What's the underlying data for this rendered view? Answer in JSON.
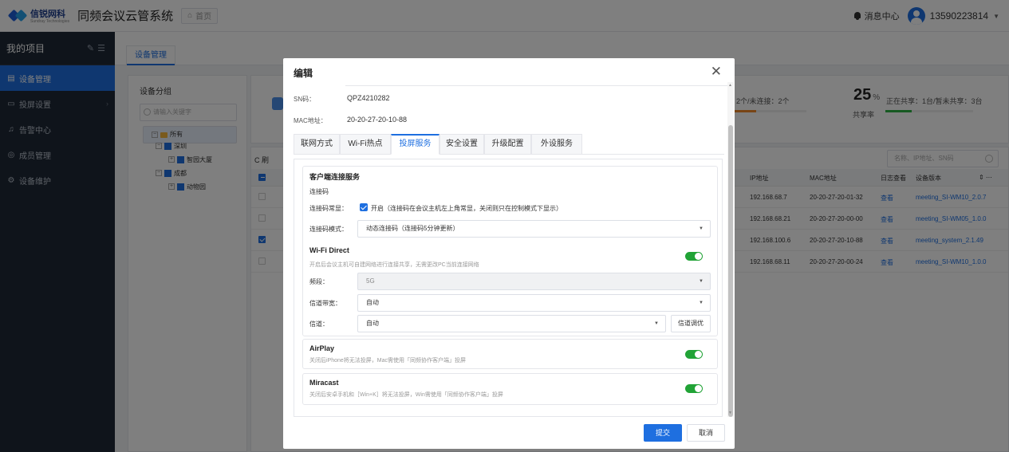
{
  "header": {
    "logo_text": "信锐网科",
    "logo_sub": "Sundray Technologies",
    "app_title": "同频会议云管系统",
    "home_label": "首页",
    "messages_label": "消息中心",
    "username": "13590223814"
  },
  "sidebar": {
    "title": "我的项目",
    "items": [
      {
        "label": "设备管理",
        "icon": "device-icon"
      },
      {
        "label": "投屏设置",
        "icon": "screen-icon"
      },
      {
        "label": "告警中心",
        "icon": "bell-icon"
      },
      {
        "label": "成员管理",
        "icon": "user-icon"
      },
      {
        "label": "设备维护",
        "icon": "wrench-icon"
      }
    ]
  },
  "page": {
    "tab": "设备管理",
    "group_panel": {
      "title": "设备分组",
      "search_placeholder": "请输入关键字",
      "tree": [
        {
          "label": "所有"
        },
        {
          "label": "深圳"
        },
        {
          "label": "智园大厦"
        },
        {
          "label": "成都"
        },
        {
          "label": "动物园"
        }
      ]
    },
    "stats": {
      "connect_text": "2个/未连接：2个",
      "share_pct": "25",
      "share_unit": "%",
      "share_label": "共享率",
      "share_text": "正在共享：1台/暂未共享：3台",
      "connect_fraction": 0.3,
      "share_fraction": 0.3
    },
    "list": {
      "refresh_label": "刷",
      "search_placeholder": "名称、IP地址、SN码",
      "columns": [
        "IP地址",
        "MAC地址",
        "日志查看",
        "设备版本"
      ],
      "rows": [
        {
          "ip": "192.168.68.7",
          "mac": "20-20-27-20-01-32",
          "log": "查看",
          "version": "meeting_SI-WM10_2.0.7",
          "checked": false
        },
        {
          "ip": "192.168.68.21",
          "mac": "20-20-27-20-00-00",
          "log": "查看",
          "version": "meeting_SI-WM05_1.0.0",
          "checked": false
        },
        {
          "ip": "192.168.100.6",
          "mac": "20-20-27-20-10-88",
          "log": "查看",
          "version": "meeting_system_2.1.49",
          "checked": true
        },
        {
          "ip": "192.168.68.11",
          "mac": "20-20-27-20-00-24",
          "log": "查看",
          "version": "meeting_SI-WM10_1.0.0",
          "checked": false
        }
      ]
    }
  },
  "modal": {
    "title": "编辑",
    "sn_label": "SN码：",
    "sn_value": "QPZ4210282",
    "mac_label": "MAC地址：",
    "mac_value": "20-20-27-20-10-88",
    "tabs": [
      "联网方式",
      "Wi-Fi热点",
      "投屏服务",
      "安全设置",
      "升级配置",
      "外设服务"
    ],
    "active_tab": "投屏服务",
    "client_service": {
      "title": "客户端连接服务",
      "code_heading": "连接码",
      "code_always_label": "连接码常显：",
      "code_always_text": "开启（连接码在会议主机左上角常显，关闭则只在控制模式下显示）",
      "code_mode_label": "连接码模式：",
      "code_mode_value": "动态连接码（连接码5分钟更新）"
    },
    "wifi_direct": {
      "title": "Wi-Fi Direct",
      "desc": "开启后会议主机可自建网络进行连接共享，无需更改PC当前连接网络",
      "band_label": "频段：",
      "band_value": "5G",
      "bandwidth_label": "信道带宽：",
      "bandwidth_value": "自动",
      "channel_label": "信道：",
      "channel_value": "自动",
      "tune_label": "信道调优"
    },
    "airplay": {
      "title": "AirPlay",
      "desc": "关闭后iPhone将无法投屏，Mac需使用「同频协作客户端」投屏"
    },
    "miracast": {
      "title": "Miracast",
      "desc": "关闭后安卓手机和［Win+K］将无法投屏，Win需使用「同频协作客户端」投屏"
    },
    "submit_label": "提交",
    "cancel_label": "取消"
  }
}
